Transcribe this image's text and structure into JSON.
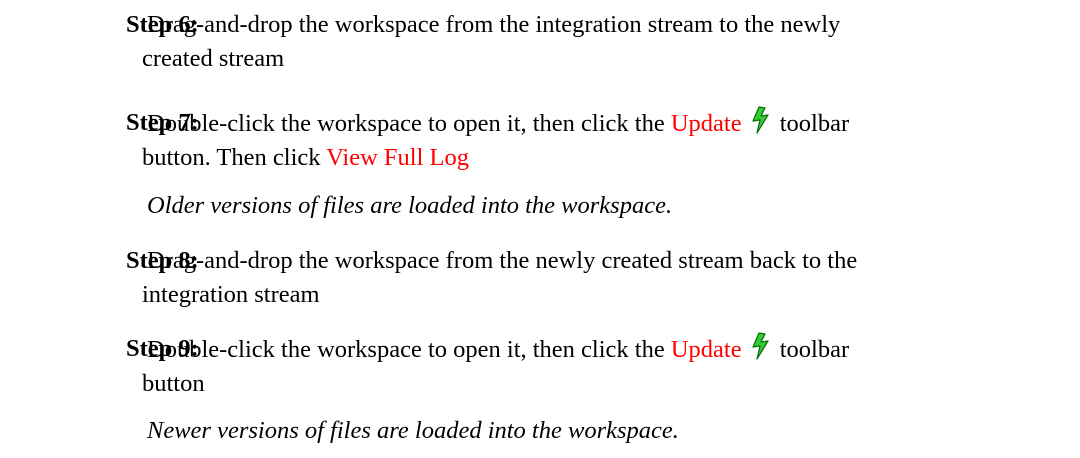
{
  "steps": [
    {
      "label": "Step 6:",
      "line1": "Drag-and-drop the workspace from the integration stream to the newly",
      "line2": "created stream"
    },
    {
      "label": "Step 7:",
      "line1_prefix": "Double-click the workspace to open it, then click the",
      "line1_link": "Update",
      "line1_suffix": "toolbar",
      "line2_prefix": "button. Then click",
      "line2_link": "View Full Log",
      "note": "Older versions of files are loaded into the workspace."
    },
    {
      "label": "Step 8:",
      "line1": "Drag-and-drop the workspace from the newly created stream back to the",
      "line2": "integration stream"
    },
    {
      "label": "Step 9:",
      "line1_prefix": "Double-click the workspace to open it, then click the",
      "line1_link": "Update",
      "line1_suffix": "toolbar",
      "line2": "button",
      "note": "Newer versions of files are loaded into the workspace."
    }
  ],
  "colors": {
    "link": "#ff0000",
    "icon_green": "#33cc33",
    "icon_dark": "#0a6b0a"
  },
  "icons": {
    "update": "lightning-bolt-update-icon"
  }
}
